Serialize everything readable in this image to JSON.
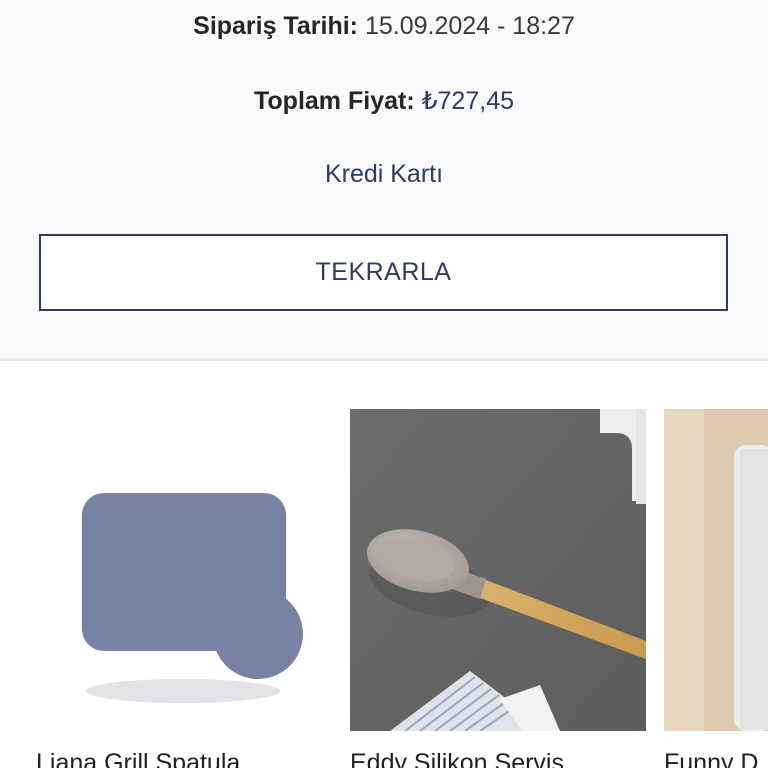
{
  "order": {
    "date_label": "Sipariş Tarihi:",
    "date_value": "15.09.2024 - 18:27",
    "total_label": "Toplam Fiyat:",
    "total_value": "₺727,45",
    "payment_method": "Kredi Kartı",
    "repeat_button_label": "TEKRARLA"
  },
  "products": [
    {
      "title": "Liana Grill Spatula",
      "image": "placeholder-image"
    },
    {
      "title": "Eddy Silikon Servis",
      "image": "wooden-silicone-spoon-photo"
    },
    {
      "title": "Funny D",
      "image": "product-photo"
    }
  ],
  "colors": {
    "accent": "#2f3b63",
    "placeholder": "#7883a3",
    "background": "#f8f9fa"
  }
}
